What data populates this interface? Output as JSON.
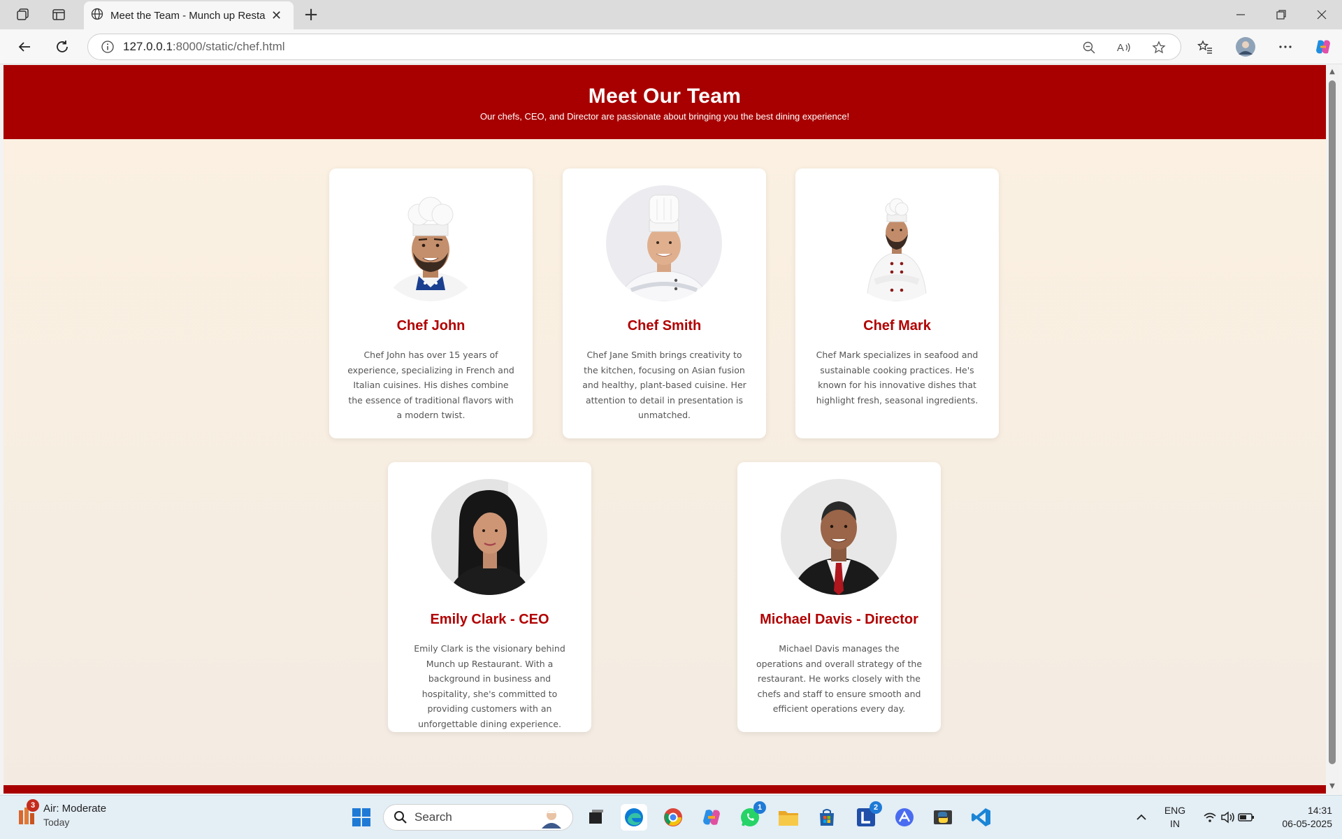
{
  "browser": {
    "tab_title": "Meet the Team - Munch up Restaurant",
    "url_host": "127.0.0.1",
    "url_path": ":8000/static/chef.html"
  },
  "page": {
    "title": "Meet Our Team",
    "subtitle": "Our chefs, CEO, and Director are passionate about bringing you the best dining experience!"
  },
  "team": [
    {
      "name": "Chef John",
      "bio": "Chef John has over 15 years of experience, specializing in French and Italian cuisines. His dishes combine the essence of traditional flavors with a modern twist."
    },
    {
      "name": "Chef Smith",
      "bio": "Chef Jane Smith brings creativity to the kitchen, focusing on Asian fusion and healthy, plant-based cuisine. Her attention to detail in presentation is unmatched."
    },
    {
      "name": "Chef Mark",
      "bio": "Chef Mark specializes in seafood and sustainable cooking practices. He's known for his innovative dishes that highlight fresh, seasonal ingredients."
    },
    {
      "name": "Emily Clark - CEO",
      "bio": "Emily Clark is the visionary behind Munch up Restaurant. With a background in business and hospitality, she's committed to providing customers with an unforgettable dining experience."
    },
    {
      "name": "Michael Davis - Director",
      "bio": "Michael Davis manages the operations and overall strategy of the restaurant. He works closely with the chefs and staff to ensure smooth and efficient operations every day."
    }
  ],
  "taskbar": {
    "weather_title": "Air: Moderate",
    "weather_sub": "Today",
    "weather_badge": "3",
    "search_label": "Search",
    "whatsapp_badge": "1",
    "l_badge": "2",
    "lang_top": "ENG",
    "lang_bottom": "IN",
    "time": "14:31",
    "date": "06-05-2025"
  },
  "colors": {
    "brand_red": "#a80000",
    "name_red": "#b10000",
    "page_bg": "#fcf1e1"
  }
}
